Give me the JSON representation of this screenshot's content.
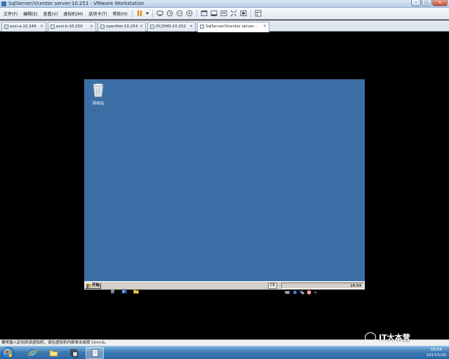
{
  "window": {
    "title": "SqlServer/Vcenter server-10.251 - VMware Workstation",
    "controls": {
      "minimize": "–",
      "maximize": "□",
      "close": "x"
    }
  },
  "menu": {
    "items": [
      "文件(F)",
      "编辑(E)",
      "查看(V)",
      "虚拟机(M)",
      "选项卡(T)",
      "帮助(H)"
    ]
  },
  "toolbar": {
    "icons": [
      "pause-icon",
      "dropdown-icon",
      "send-ctrl-alt-del-icon",
      "snapshot-icon",
      "revert-snapshot-icon",
      "snapshot-manager-icon",
      "fullscreen-icon",
      "console-view-icon",
      "thumbnail-icon",
      "unity-icon",
      "stretch-icon",
      "library-icon"
    ]
  },
  "tabs": [
    {
      "label": "esxi-a-10.249",
      "active": false
    },
    {
      "label": "esxi-b-10.250",
      "active": false
    },
    {
      "label": "openfiler-10.254",
      "active": false
    },
    {
      "label": "DC/DNS-10.252",
      "active": false
    },
    {
      "label": "SqlServer/Vcenter server...",
      "active": true
    }
  ],
  "guest": {
    "background": "#3a6ea5",
    "desktop": {
      "recycle_bin_label": "回收站"
    },
    "taskbar": {
      "start_label": "开始",
      "ime_label": "CK",
      "clock": "18:54"
    }
  },
  "statusbar": {
    "hint": "要将输入定向到该虚拟机，请在虚拟机内部单击或按 Ctrl+G。"
  },
  "host": {
    "taskbar": {
      "apps": [
        "windows-explorer-icon",
        "internet-explorer-icon",
        "folder-icon",
        "vmware-workstation-icon",
        "notepad-icon"
      ]
    },
    "clock": {
      "time": "18:54",
      "date": "2017/5/30"
    }
  },
  "watermark": {
    "text": "IT大本营"
  }
}
